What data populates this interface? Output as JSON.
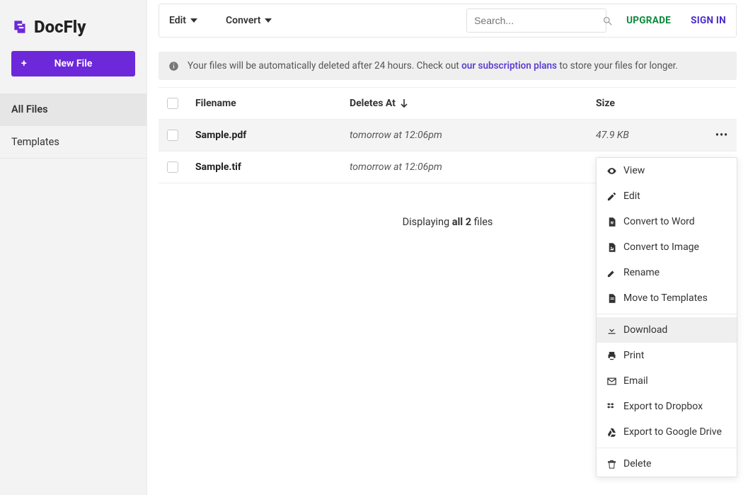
{
  "brand": {
    "name": "DocFly"
  },
  "sidebar": {
    "new_file_label": "New File",
    "items": [
      {
        "label": "All Files"
      },
      {
        "label": "Templates"
      }
    ]
  },
  "toolbar": {
    "edit_label": "Edit",
    "convert_label": "Convert",
    "search_placeholder": "Search...",
    "upgrade_label": "UPGRADE",
    "signin_label": "SIGN IN"
  },
  "banner": {
    "before": "Your files will be automatically deleted after 24 hours. Check out ",
    "link": "our subscription plans",
    "after": " to store your files for longer."
  },
  "table": {
    "headers": {
      "filename": "Filename",
      "deletes_at": "Deletes At",
      "size": "Size"
    },
    "rows": [
      {
        "filename": "Sample.pdf",
        "deletes_at": "tomorrow at 12:06pm",
        "size": "47.9 KB"
      },
      {
        "filename": "Sample.tif",
        "deletes_at": "tomorrow at 12:06pm",
        "size": ""
      }
    ]
  },
  "pager": {
    "before": "Displaying ",
    "bold": "all 2",
    "after": " files"
  },
  "context_menu": {
    "items": [
      {
        "label": "View"
      },
      {
        "label": "Edit"
      },
      {
        "label": "Convert to Word"
      },
      {
        "label": "Convert to Image"
      },
      {
        "label": "Rename"
      },
      {
        "label": "Move to Templates"
      }
    ],
    "items2": [
      {
        "label": "Download"
      },
      {
        "label": "Print"
      },
      {
        "label": "Email"
      },
      {
        "label": "Export to Dropbox"
      },
      {
        "label": "Export to Google Drive"
      }
    ],
    "items3": [
      {
        "label": "Delete"
      }
    ]
  }
}
